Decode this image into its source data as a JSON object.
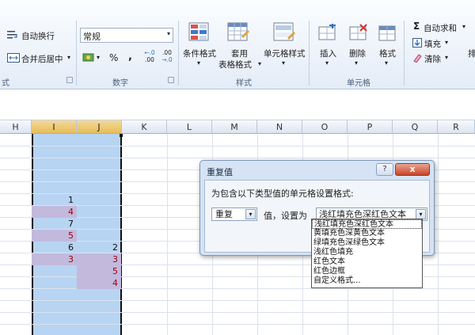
{
  "ribbon": {
    "alignment": {
      "wrap_text": "自动换行",
      "merge_center": "合并后居中"
    },
    "number": {
      "format_value": "常规",
      "percent": "%",
      "comma": ",",
      "inc_decimal_top": "←.0",
      "inc_decimal_bottom": ".00",
      "dec_decimal_top": ".00",
      "dec_decimal_bottom": "→.0",
      "group_label": "数字"
    },
    "styles": {
      "cond_format": "条件格式",
      "table_format_1": "套用",
      "table_format_2": "表格格式",
      "cell_styles": "单元格样式",
      "group_label": "样式"
    },
    "cells": {
      "insert": "插入",
      "delete": "删除",
      "format": "格式",
      "group_label": "单元格"
    },
    "editing": {
      "autosum": "自动求和",
      "fill": "填充",
      "clear": "清除",
      "sort_cut": "排"
    },
    "left_group_label": "式"
  },
  "grid": {
    "columns": [
      "H",
      "I",
      "J",
      "K",
      "L",
      "M",
      "N",
      "O",
      "P",
      "Q",
      "R"
    ],
    "selected_columns": [
      "I",
      "J"
    ],
    "col_i_values": [
      "1",
      "4",
      "7",
      "5",
      "6",
      "3"
    ],
    "col_i_duplicate": [
      false,
      true,
      false,
      true,
      false,
      true
    ],
    "col_j_values": [
      "2",
      "3",
      "5",
      "4"
    ],
    "col_j_duplicate": [
      false,
      true,
      true,
      true
    ]
  },
  "dialog": {
    "title": "重复值",
    "help": "?",
    "close": "x",
    "prompt": "为包含以下类型值的单元格设置格式:",
    "rule_value": "重复",
    "set_label": "值，设置为",
    "format_value": "浅红填充色深红色文本",
    "dropdown_arrow": "▾"
  },
  "format_options": [
    "浅红填充色深红色文本",
    "黄填充色深黄色文本",
    "绿填充色深绿色文本",
    "浅红色填充",
    "红色文本",
    "红色边框",
    "自定义格式..."
  ],
  "colors": {
    "duplicate_fill": "#c2b9dd",
    "duplicate_text": "#9c0006",
    "selection": "#b7d4f3",
    "dialog_bg": "#d5e3f5",
    "close_button": "#c8452a"
  }
}
